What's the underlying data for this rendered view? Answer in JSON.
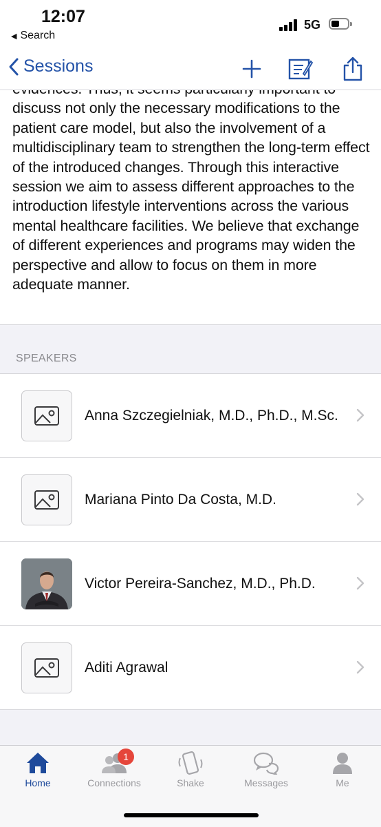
{
  "status_bar": {
    "time": "12:07",
    "back_app": "Search",
    "network": "5G"
  },
  "nav": {
    "back_label": "Sessions",
    "icons": [
      "plus-icon",
      "note-edit-icon",
      "share-icon"
    ]
  },
  "description": {
    "text": "evidences. Thus, it seems particularly important to discuss not only the necessary modifications to the patient care model, but also the involvement of a multidisciplinary team to strengthen the long-term effect of the introduced changes. Through this interactive session we aim to assess different approaches to the introduction lifestyle interventions across the various mental healthcare facilities. We believe that exchange of different experiences and programs may widen the perspective and allow to focus on them in more adequate manner."
  },
  "speakers": {
    "header": "SPEAKERS",
    "items": [
      {
        "name": "Anna Szczegielniak, M.D., Ph.D., M.Sc.",
        "photo": "placeholder-image-icon"
      },
      {
        "name": "Mariana Pinto Da Costa, M.D.",
        "photo": "placeholder-image-icon"
      },
      {
        "name": "Victor Pereira-Sanchez, M.D., Ph.D.",
        "photo": "speaker-photo"
      },
      {
        "name": "Aditi Agrawal",
        "photo": "placeholder-image-icon"
      }
    ]
  },
  "tabs": [
    {
      "label": "Home",
      "icon": "home-icon",
      "active": true
    },
    {
      "label": "Connections",
      "icon": "people-icon",
      "badge": "1"
    },
    {
      "label": "Shake",
      "icon": "phone-shake-icon"
    },
    {
      "label": "Messages",
      "icon": "chat-bubbles-icon"
    },
    {
      "label": "Me",
      "icon": "person-icon"
    }
  ],
  "colors": {
    "accent": "#2453a8",
    "tab_active": "#1e4a9b",
    "badge": "#e5463b",
    "background": "#f2f2f7"
  }
}
